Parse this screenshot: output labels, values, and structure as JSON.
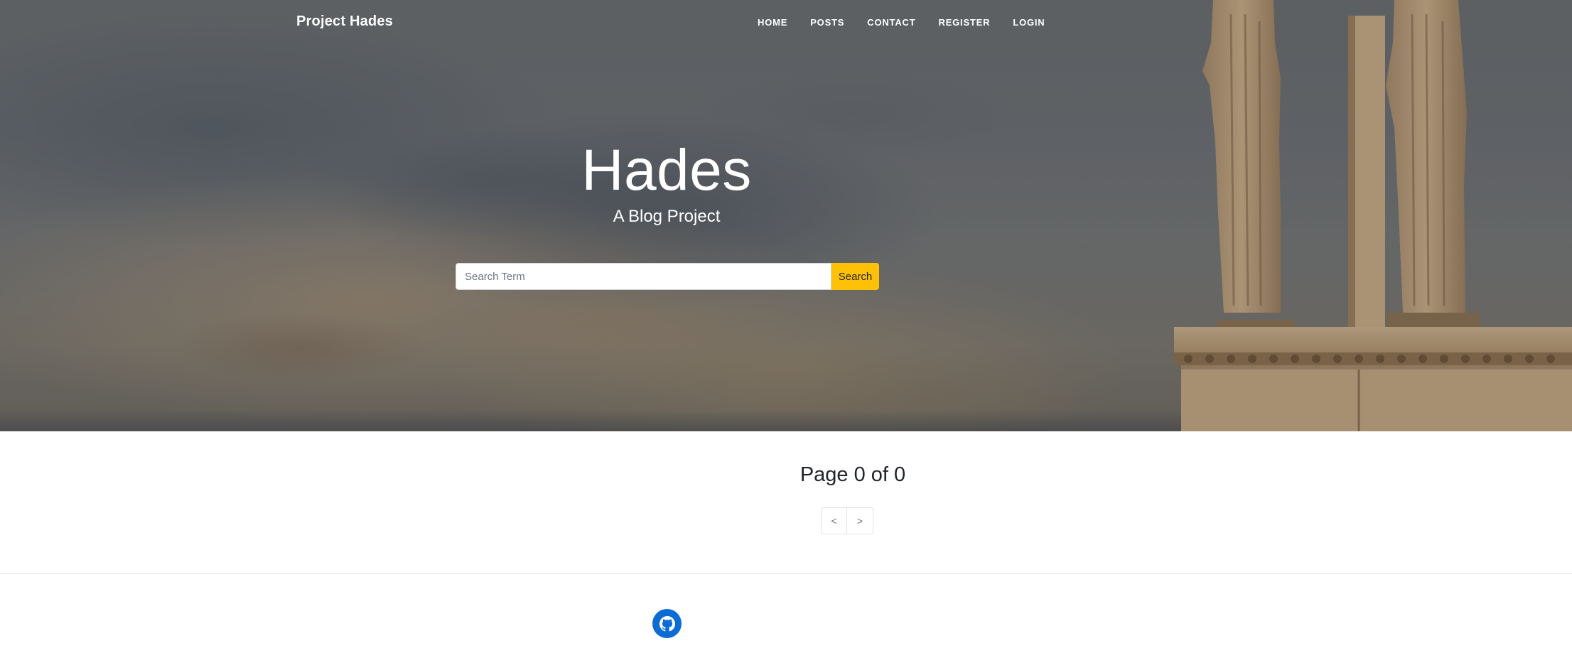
{
  "navbar": {
    "brand": "Project Hades",
    "links": [
      {
        "label": "HOME"
      },
      {
        "label": "POSTS"
      },
      {
        "label": "CONTACT"
      },
      {
        "label": "REGISTER"
      },
      {
        "label": "LOGIN"
      }
    ]
  },
  "hero": {
    "title": "Hades",
    "subtitle": "A Blog Project"
  },
  "search": {
    "placeholder": "Search Term",
    "value": "",
    "button_label": "Search"
  },
  "main": {
    "pagination_text": "Page 0 of 0",
    "prev_label": "<",
    "next_label": ">"
  },
  "footer": {
    "social_icon": "github-icon"
  },
  "colors": {
    "accent": "#ffc107",
    "github_circle": "#0d6bd4",
    "text_dark": "#212529"
  }
}
